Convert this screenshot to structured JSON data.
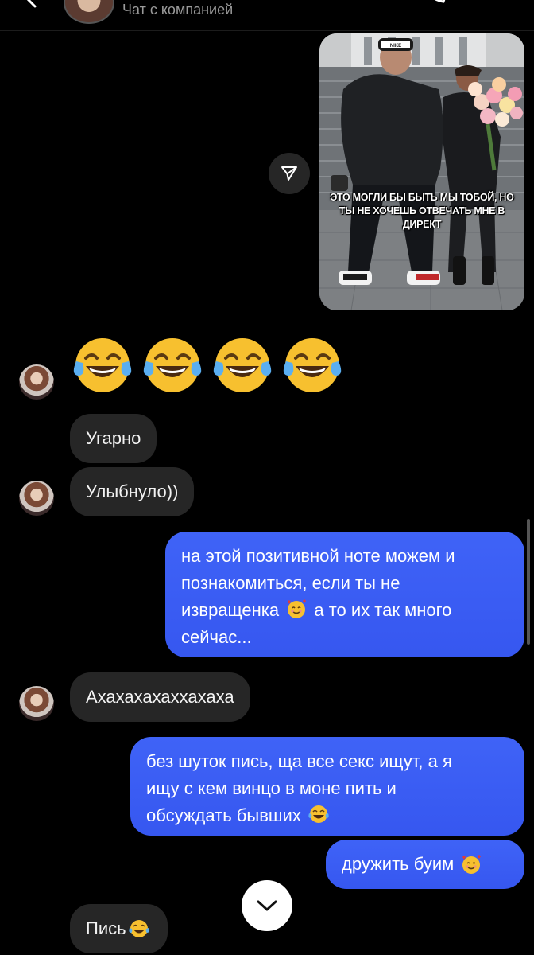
{
  "header": {
    "subtitle": "Чат с компанией",
    "icons": [
      "chevron-left-icon",
      "phone-icon",
      "video-icon"
    ]
  },
  "shared_post": {
    "meme_caption": "ЭТО МОГЛИ БЫ БЫТЬ МЫ ТОБОЙ, НО ТЫ НЕ ХОЧЕШЬ ОТВЕЧАТЬ МНЕ В ДИРЕКТ",
    "cap_text": "NIKE",
    "share_icon": "send-icon"
  },
  "messages": {
    "emoji_reaction": [
      "😂",
      "😂",
      "😂",
      "😂"
    ],
    "m1": "Угарно",
    "m2": "Улыбнуло))",
    "m3_line1": "на этой позитивной ноте можем и",
    "m3_line2": "познакомиться, если ты не",
    "m3_line3a": "извращенка",
    "m3_line3b": "а то их так много",
    "m3_line4": "сейчас...",
    "m4": "Ахахахахаххахаха",
    "m5_line1": "без шуток пись, ща все секс ищут, а я",
    "m5_line2": "ищу с кем винцо в моне пить и",
    "m5_line3": "обсуждать бывших",
    "m6": "дружить буим",
    "m7": "Пись"
  },
  "colors": {
    "outgoing_bubble": "#3d5cf5",
    "incoming_bubble": "#262626",
    "background": "#000000"
  },
  "scroll_button_icon": "chevron-down-icon"
}
